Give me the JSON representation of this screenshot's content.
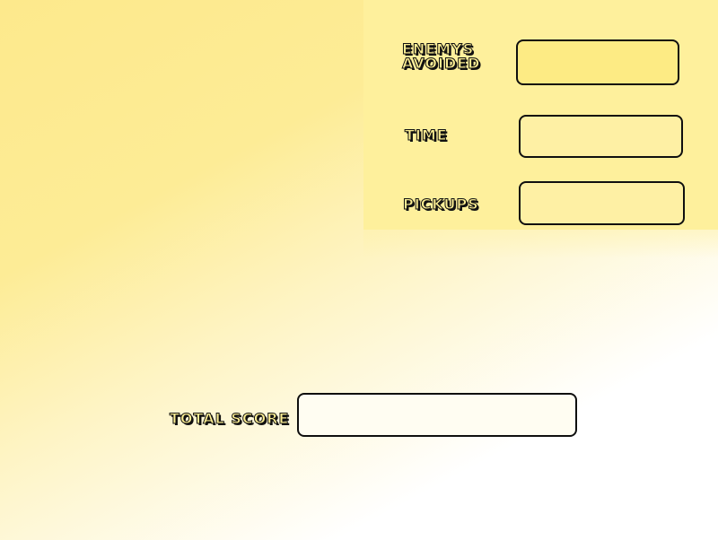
{
  "score_screen": {
    "enemys_avoided": {
      "label": "ENEMYS\nAVOIDED",
      "value": ""
    },
    "time": {
      "label": "TIME",
      "value": ""
    },
    "pickups": {
      "label": "PICKUPS",
      "value": ""
    },
    "total_score": {
      "label": "TOTAL SCORE",
      "value": ""
    }
  },
  "colors": {
    "background_top": "#fde98c",
    "background_bottom": "#ffffff",
    "panel": "#fef09c",
    "label_fill": "#fdef93",
    "label_outline": "#111111",
    "field_border": "#0f0f0f"
  }
}
